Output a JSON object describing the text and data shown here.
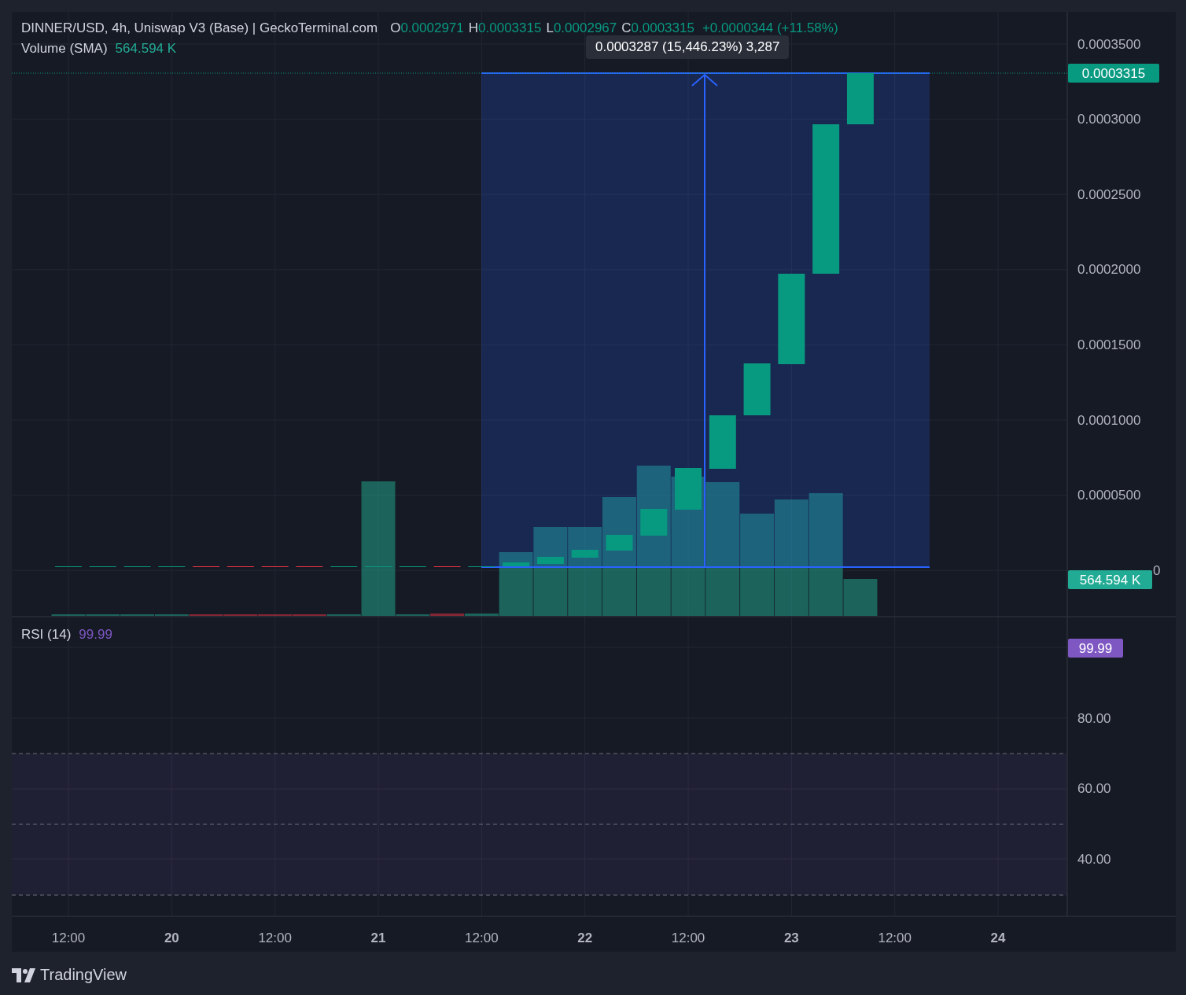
{
  "legend": {
    "title": "DINNER/USD, 4h, Uniswap V3 (Base) | GeckoTerminal.com",
    "ohlc": [
      {
        "label": "O",
        "value": "0.0002971"
      },
      {
        "label": "H",
        "value": "0.0003315"
      },
      {
        "label": "L",
        "value": "0.0002967"
      },
      {
        "label": "C",
        "value": "0.0003315"
      }
    ],
    "change": "+0.0000344 (+11.58%)"
  },
  "volume_legend": {
    "label": "Volume (SMA)",
    "value": "564.594 K"
  },
  "measure": {
    "label": "0.0003287 (15,446.23%) 3,287"
  },
  "price_axis": [
    "0.0003500",
    "0.0003000",
    "0.0002500",
    "0.0002000",
    "0.0001500",
    "0.0001000",
    "0.0000500"
  ],
  "price_axis_tail": "0",
  "price_badge": "0.0003315",
  "volume_badge": "564.594 K",
  "rsi": {
    "label": "RSI (14)",
    "value": "99.99",
    "badge": "99.99",
    "axis": [
      "80.00",
      "60.00",
      "40.00"
    ]
  },
  "time_axis": [
    {
      "label": "12:00",
      "kind": "time"
    },
    {
      "label": "20",
      "kind": "day"
    },
    {
      "label": "12:00",
      "kind": "time"
    },
    {
      "label": "21",
      "kind": "day"
    },
    {
      "label": "12:00",
      "kind": "time"
    },
    {
      "label": "22",
      "kind": "day"
    },
    {
      "label": "12:00",
      "kind": "time"
    },
    {
      "label": "23",
      "kind": "day"
    },
    {
      "label": "12:00",
      "kind": "time"
    },
    {
      "label": "24",
      "kind": "day"
    }
  ],
  "footer": {
    "brand": "TradingView"
  }
}
